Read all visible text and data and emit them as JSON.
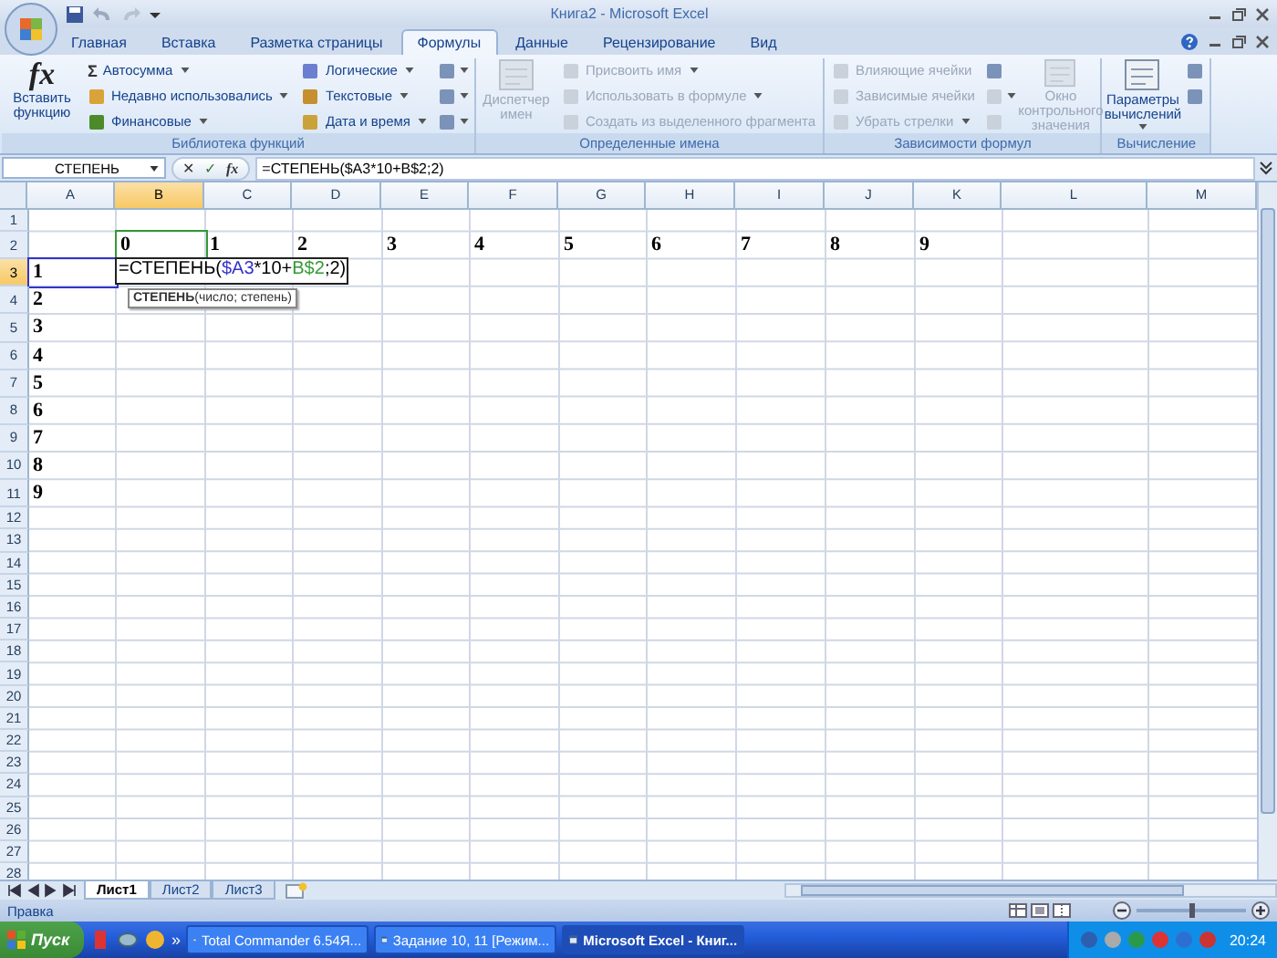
{
  "window": {
    "title": "Книга2 - Microsoft Excel"
  },
  "tabs": [
    {
      "label": "Главная",
      "selected": false
    },
    {
      "label": "Вставка",
      "selected": false
    },
    {
      "label": "Разметка страницы",
      "selected": false
    },
    {
      "label": "Формулы",
      "selected": true
    },
    {
      "label": "Данные",
      "selected": false
    },
    {
      "label": "Рецензирование",
      "selected": false
    },
    {
      "label": "Вид",
      "selected": false
    }
  ],
  "ribbon_groups": [
    {
      "title": "Библиотека функций",
      "items": [
        {
          "kind": "large",
          "glyph": "fx",
          "label": "Вставить функцию",
          "disabled": false,
          "menu": false
        },
        {
          "kind": "small",
          "glyph": "Σ",
          "label": "Автосумма",
          "disabled": false,
          "menu": true
        },
        {
          "kind": "small",
          "label": "Недавно использовались",
          "disabled": false,
          "menu": true
        },
        {
          "kind": "small",
          "label": "Финансовые",
          "disabled": false,
          "menu": true
        },
        {
          "kind": "small",
          "label": "Логические",
          "disabled": false,
          "menu": true
        },
        {
          "kind": "small",
          "label": "Текстовые",
          "disabled": false,
          "menu": true
        },
        {
          "kind": "small",
          "label": "Дата и время",
          "disabled": false,
          "menu": true
        },
        {
          "kind": "icon",
          "disabled": false,
          "menu": true
        },
        {
          "kind": "icon",
          "disabled": false,
          "menu": true
        },
        {
          "kind": "icon",
          "disabled": false,
          "menu": true
        }
      ]
    },
    {
      "title": "Определенные имена",
      "items": [
        {
          "kind": "large",
          "label": "Диспетчер имен",
          "disabled": true,
          "menu": false
        },
        {
          "kind": "small",
          "label": "Присвоить имя",
          "disabled": true,
          "menu": true
        },
        {
          "kind": "small",
          "label": "Использовать в формуле",
          "disabled": true,
          "menu": true
        },
        {
          "kind": "small",
          "label": "Создать из выделенного фрагмента",
          "disabled": true,
          "menu": false
        }
      ]
    },
    {
      "title": "Зависимости формул",
      "items": [
        {
          "kind": "small",
          "label": "Влияющие ячейки",
          "disabled": true,
          "menu": false
        },
        {
          "kind": "small",
          "label": "Зависимые ячейки",
          "disabled": true,
          "menu": false
        },
        {
          "kind": "small",
          "label": "Убрать стрелки",
          "disabled": true,
          "menu": true
        },
        {
          "kind": "icon",
          "disabled": false,
          "menu": false
        },
        {
          "kind": "icon",
          "disabled": true,
          "menu": true
        },
        {
          "kind": "icon",
          "disabled": true,
          "menu": false
        },
        {
          "kind": "large",
          "label": "Окно контрольного значения",
          "disabled": true,
          "menu": false
        }
      ]
    },
    {
      "title": "Вычисление",
      "items": [
        {
          "kind": "large",
          "label": "Параметры вычислений",
          "disabled": false,
          "menu": true
        },
        {
          "kind": "icon",
          "disabled": false,
          "menu": false
        },
        {
          "kind": "icon",
          "disabled": false,
          "menu": false
        }
      ]
    }
  ],
  "formula_bar": {
    "name_box": "СТЕПЕНЬ",
    "cancel": "✕",
    "enter": "✓",
    "fx": "fx",
    "value": "=СТЕПЕНЬ($A3*10+B$2;2)"
  },
  "columns": [
    {
      "label": "A",
      "selected": false
    },
    {
      "label": "B",
      "selected": true
    },
    {
      "label": "C",
      "selected": false
    },
    {
      "label": "D",
      "selected": false
    },
    {
      "label": "E",
      "selected": false
    },
    {
      "label": "F",
      "selected": false
    },
    {
      "label": "G",
      "selected": false
    },
    {
      "label": "H",
      "selected": false
    },
    {
      "label": "I",
      "selected": false
    },
    {
      "label": "J",
      "selected": false
    },
    {
      "label": "K",
      "selected": false
    },
    {
      "label": "L",
      "selected": false
    },
    {
      "label": "M",
      "selected": false
    }
  ],
  "rows": [
    {
      "header": "1",
      "selected": false
    },
    {
      "header": "2",
      "selected": false,
      "cells": [
        null,
        {
          "kind": "text",
          "text": "0",
          "color": "#339933"
        },
        {
          "kind": "text",
          "text": "1"
        },
        {
          "kind": "text",
          "text": "2"
        },
        {
          "kind": "text",
          "text": "3"
        },
        {
          "kind": "text",
          "text": "4"
        },
        {
          "kind": "text",
          "text": "5"
        },
        {
          "kind": "text",
          "text": "6"
        },
        {
          "kind": "text",
          "text": "7"
        },
        {
          "kind": "text",
          "text": "8"
        },
        {
          "kind": "text",
          "text": "9"
        }
      ]
    },
    {
      "header": "3",
      "selected": true,
      "cells": [
        {
          "kind": "text",
          "text": "1",
          "color": "#3333cc"
        },
        {
          "kind": "formula",
          "parts": [
            {
              "text": "=СТЕПЕНЬ(",
              "color": "#000000"
            },
            {
              "text": "$A3",
              "color": "#3333cc"
            },
            {
              "text": "*10+",
              "color": "#000000"
            },
            {
              "text": "B$2",
              "color": "#339933"
            },
            {
              "text": ";2)",
              "color": "#000000"
            }
          ],
          "tooltip": "**СТЕПЕНЬ**(число; степень)"
        }
      ]
    },
    {
      "header": "4",
      "selected": false,
      "cells": [
        {
          "kind": "text",
          "text": "2"
        }
      ]
    },
    {
      "header": "5",
      "selected": false,
      "cells": [
        {
          "kind": "text",
          "text": "3"
        }
      ]
    },
    {
      "header": "6",
      "selected": false,
      "cells": [
        {
          "kind": "text",
          "text": "4"
        }
      ]
    },
    {
      "header": "7",
      "selected": false,
      "cells": [
        {
          "kind": "text",
          "text": "5"
        }
      ]
    },
    {
      "header": "8",
      "selected": false,
      "cells": [
        {
          "kind": "text",
          "text": "6"
        }
      ]
    },
    {
      "header": "9",
      "selected": false,
      "cells": [
        {
          "kind": "text",
          "text": "7"
        }
      ]
    },
    {
      "header": "10",
      "selected": false,
      "cells": [
        {
          "kind": "text",
          "text": "8"
        }
      ]
    },
    {
      "header": "11",
      "selected": false,
      "cells": [
        {
          "kind": "text",
          "text": "9"
        }
      ]
    },
    {
      "header": "12",
      "selected": false
    },
    {
      "header": "13",
      "selected": false
    },
    {
      "header": "14",
      "selected": false
    },
    {
      "header": "15",
      "selected": false
    },
    {
      "header": "16",
      "selected": false
    },
    {
      "header": "17",
      "selected": false
    },
    {
      "header": "18",
      "selected": false
    },
    {
      "header": "19",
      "selected": false
    },
    {
      "header": "20",
      "selected": false
    },
    {
      "header": "21",
      "selected": false
    },
    {
      "header": "22",
      "selected": false
    },
    {
      "header": "23",
      "selected": false
    },
    {
      "header": "24",
      "selected": false
    },
    {
      "header": "25",
      "selected": false
    },
    {
      "header": "26",
      "selected": false
    },
    {
      "header": "27",
      "selected": false
    },
    {
      "header": "28",
      "selected": false
    }
  ],
  "sheet_tabs": [
    {
      "label": "Лист1",
      "selected": true
    },
    {
      "label": "Лист2",
      "selected": false
    },
    {
      "label": "Лист3",
      "selected": false
    }
  ],
  "status_bar": {
    "mode": "Правка",
    "zoom": {
      "level": 0.5
    }
  },
  "taskbar": {
    "start": "Пуск",
    "more": "»",
    "tasks": [
      {
        "label": "Total Commander 6.54Я...",
        "selected": false
      },
      {
        "label": "Задание 10, 11 [Режим...",
        "selected": false
      },
      {
        "label": "Microsoft Excel - Книг...",
        "selected": true
      }
    ],
    "clock": "20:24"
  }
}
